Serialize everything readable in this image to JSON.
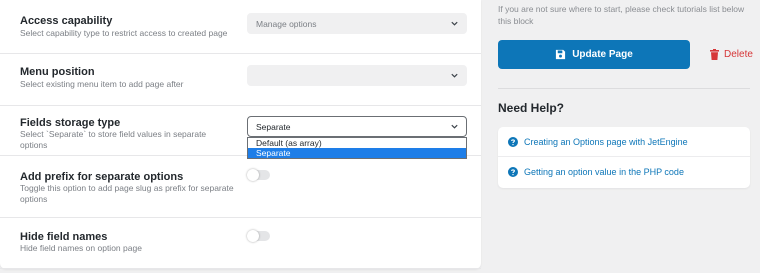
{
  "settings": {
    "access_capability": {
      "label": "Access capability",
      "description": "Select capability type to restrict access to created page",
      "value": "Manage options"
    },
    "menu_position": {
      "label": "Menu position",
      "description": "Select existing menu item to add page after",
      "value": ""
    },
    "fields_storage_type": {
      "label": "Fields storage type",
      "description": "Select `Separate` to store field values in separate options",
      "value": "Separate",
      "options": [
        "Default (as array)",
        "Separate"
      ]
    },
    "add_prefix": {
      "label": "Add prefix for separate options",
      "description": "Toggle this option to add page slug as prefix for separate options",
      "enabled": false
    },
    "hide_field_names": {
      "label": "Hide field names",
      "description": "Hide field names on option page",
      "enabled": false
    }
  },
  "sidebar": {
    "hint": "If you are not sure where to start, please check tutorials list below this block",
    "update_label": "Update Page",
    "delete_label": "Delete",
    "help_title": "Need Help?",
    "help_links": [
      "Creating an Options page with JetEngine",
      "Getting an option value in the PHP code"
    ]
  },
  "colors": {
    "primary": "#0d76b8",
    "danger": "#d63638",
    "selected_option": "#1e7ee8"
  },
  "icons": {
    "update": "save-disk-icon",
    "delete": "trash-icon",
    "help": "question-circle-icon",
    "select": "chevron-down-icon"
  }
}
